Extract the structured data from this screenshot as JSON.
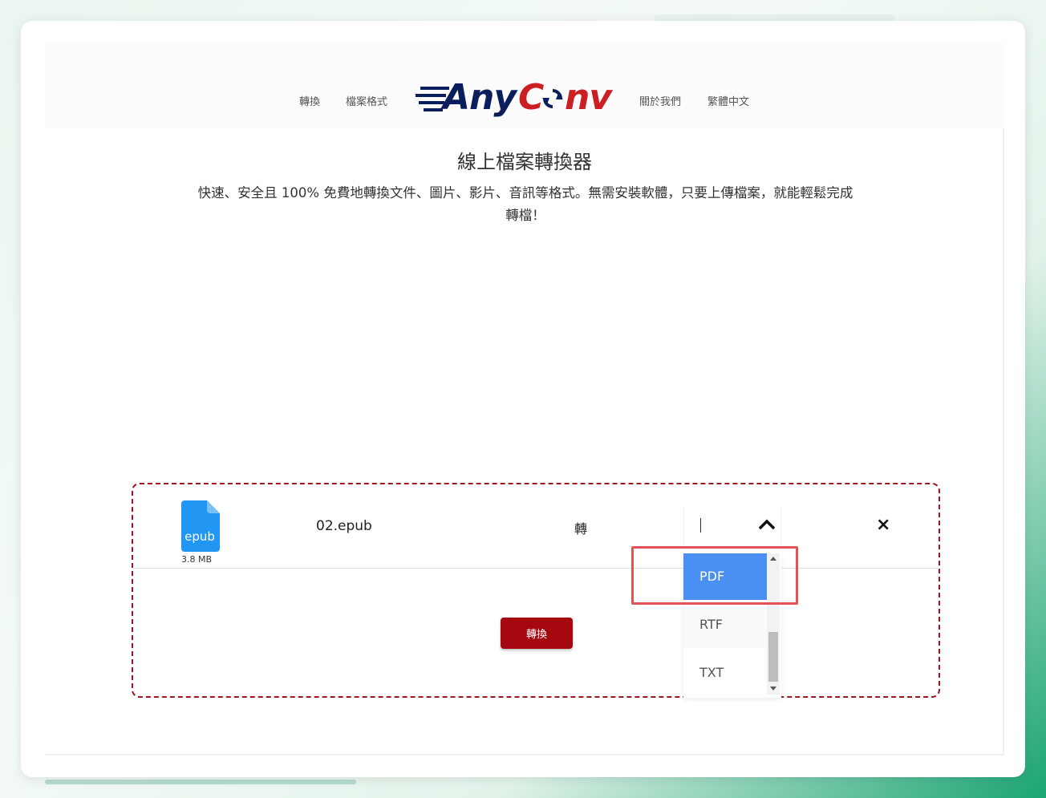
{
  "nav": {
    "left": [
      "轉換",
      "檔案格式"
    ],
    "right": [
      "關於我們",
      "繁體中文"
    ]
  },
  "logo": {
    "text_any": "Any",
    "text_c": "C",
    "text_onv": "nv",
    "colors": {
      "dark": "#0a1e5e",
      "red": "#cc1f24"
    }
  },
  "hero": {
    "title": "線上檔案轉換器",
    "description": "快速、安全且 100% 免費地轉換文件、圖片、影片、音訊等格式。無需安裝軟體，只要上傳檔案，就能輕鬆完成轉檔！"
  },
  "upload": {
    "file": {
      "icon_label": "epub",
      "size": "3.8 MB",
      "name": "02.epub"
    },
    "to_label": "轉",
    "format_options": [
      "PDF",
      "RTF",
      "TXT"
    ],
    "selected_format": "PDF",
    "convert_label": "轉換",
    "close_symbol": "×"
  },
  "colors": {
    "accent": "#a5090f",
    "selected": "#4a8ff2",
    "highlight": "#e05356",
    "file_icon": "#2196f3"
  }
}
